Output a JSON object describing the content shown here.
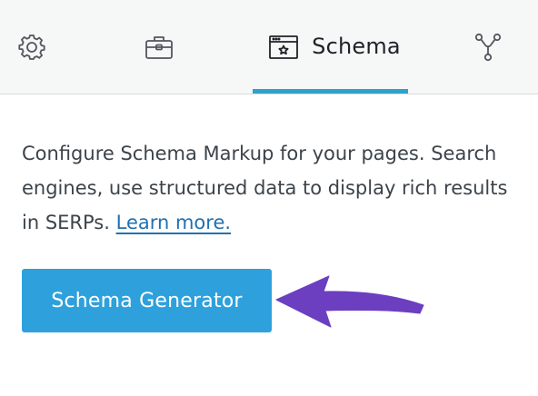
{
  "tabs": [
    {
      "id": "settings",
      "icon": "gear-icon",
      "label": ""
    },
    {
      "id": "tools",
      "icon": "toolbox-icon",
      "label": ""
    },
    {
      "id": "schema",
      "icon": "schema-window-star-icon",
      "label": "Schema",
      "active": true
    },
    {
      "id": "social",
      "icon": "share-nodes-icon",
      "label": ""
    }
  ],
  "description": {
    "text": "Configure Schema Markup for your pages. Search engines, use structured data to display rich results in SERPs.",
    "link_label": "Learn more."
  },
  "schema_generator_button": {
    "label": "Schema Generator"
  },
  "colors": {
    "accent": "#2ea2cc",
    "button": "#2ea1dc",
    "link": "#2271b1",
    "annotation_arrow": "#6b3fc0"
  }
}
